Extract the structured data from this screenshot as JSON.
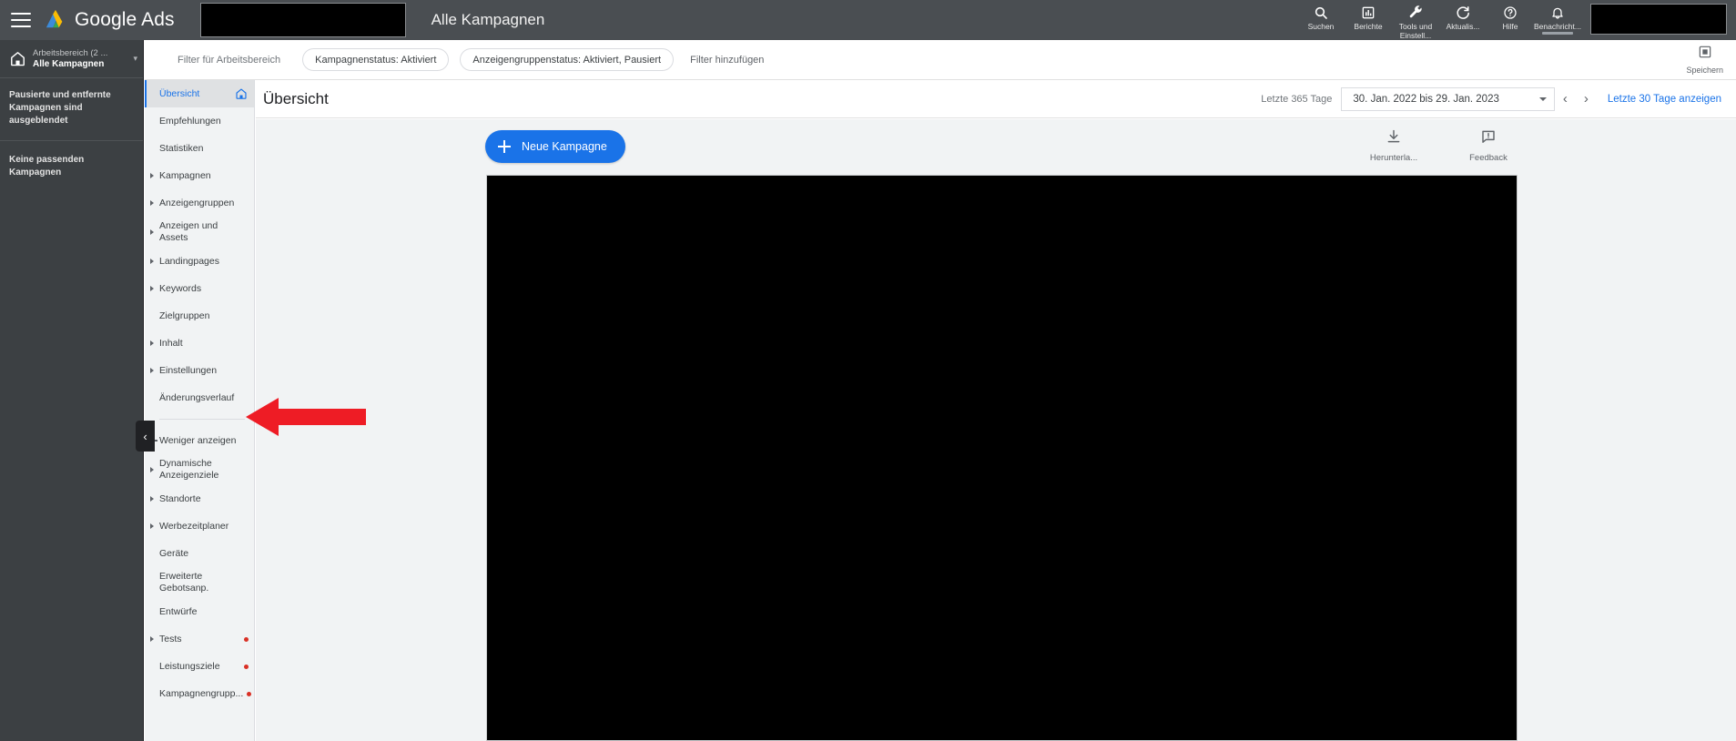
{
  "topbar": {
    "menu_icon": "hamburger-menu-icon",
    "logo_text": "Google Ads",
    "account_selector_value": "",
    "page_context_label": "Alle Kampagnen",
    "actions": [
      {
        "label": "Suchen",
        "icon": "search-icon"
      },
      {
        "label": "Berichte",
        "icon": "reports-bar-chart-icon"
      },
      {
        "label": "Tools und Einstell...",
        "icon": "wrench-tools-icon"
      },
      {
        "label": "Aktualis...",
        "icon": "refresh-icon"
      },
      {
        "label": "Hilfe",
        "icon": "help-question-icon"
      },
      {
        "label": "Benachricht...",
        "icon": "notification-bell-icon"
      }
    ],
    "user_badge_value": ""
  },
  "dark_sidebar": {
    "home_icon": "home-icon",
    "workspace_line1": "Arbeitsbereich (2 ...",
    "workspace_line2": "Alle Kampagnen",
    "workspace_caret": "chevron-down-icon",
    "note1": "Pausierte und entfernte Kampagnen sind ausgeblendet",
    "note2": "Keine passenden Kampagnen"
  },
  "filterbar": {
    "label": "Filter für Arbeitsbereich",
    "chips": [
      "Kampagnenstatus: Aktiviert",
      "Anzeigengruppenstatus: Aktiviert, Pausiert"
    ],
    "add_filter": "Filter hinzufügen",
    "save_label": "Speichern",
    "save_icon": "save-disk-icon"
  },
  "leftnav": {
    "items": [
      {
        "label": "Übersicht",
        "active": true,
        "expandable": false,
        "home": true,
        "dot": false
      },
      {
        "label": "Empfehlungen",
        "active": false,
        "expandable": false,
        "home": false,
        "dot": false
      },
      {
        "label": "Statistiken",
        "active": false,
        "expandable": false,
        "home": false,
        "dot": false
      },
      {
        "label": "Kampagnen",
        "active": false,
        "expandable": true,
        "home": false,
        "dot": false
      },
      {
        "label": "Anzeigengruppen",
        "active": false,
        "expandable": true,
        "home": false,
        "dot": false
      },
      {
        "label": "Anzeigen und Assets",
        "active": false,
        "expandable": true,
        "home": false,
        "dot": false
      },
      {
        "label": "Landingpages",
        "active": false,
        "expandable": true,
        "home": false,
        "dot": false
      },
      {
        "label": "Keywords",
        "active": false,
        "expandable": true,
        "home": false,
        "dot": false
      },
      {
        "label": "Zielgruppen",
        "active": false,
        "expandable": false,
        "home": false,
        "dot": false
      },
      {
        "label": "Inhalt",
        "active": false,
        "expandable": true,
        "home": false,
        "dot": false
      },
      {
        "label": "Einstellungen",
        "active": false,
        "expandable": true,
        "home": false,
        "dot": false
      },
      {
        "label": "Änderungsverlauf",
        "active": false,
        "expandable": false,
        "home": false,
        "dot": false
      }
    ],
    "less_label": "Weniger anzeigen",
    "items2": [
      {
        "label": "Dynamische Anzeigenziele",
        "active": false,
        "expandable": true,
        "home": false,
        "dot": false
      },
      {
        "label": "Standorte",
        "active": false,
        "expandable": true,
        "home": false,
        "dot": false
      },
      {
        "label": "Werbezeitplaner",
        "active": false,
        "expandable": true,
        "home": false,
        "dot": false
      },
      {
        "label": "Geräte",
        "active": false,
        "expandable": false,
        "home": false,
        "dot": false
      },
      {
        "label": "Erweiterte Gebotsanp.",
        "active": false,
        "expandable": false,
        "home": false,
        "dot": false
      },
      {
        "label": "Entwürfe",
        "active": false,
        "expandable": false,
        "home": false,
        "dot": false
      },
      {
        "label": "Tests",
        "active": false,
        "expandable": true,
        "home": false,
        "dot": true
      },
      {
        "label": "Leistungsziele",
        "active": false,
        "expandable": false,
        "home": false,
        "dot": true
      },
      {
        "label": "Kampagnengrupp...",
        "active": false,
        "expandable": false,
        "home": false,
        "dot": true
      }
    ],
    "collapse_icon": "chevron-left-icon"
  },
  "pageheader": {
    "title": "Übersicht",
    "date_prefix": "Letzte 365 Tage",
    "date_range": "30. Jan. 2022 bis 29. Jan. 2023",
    "prev_icon": "chevron-left-icon",
    "next_icon": "chevron-right-icon",
    "last30_link": "Letzte 30 Tage anzeigen"
  },
  "content": {
    "new_campaign_label": "Neue Kampagne",
    "new_campaign_icon": "plus-icon",
    "actions": [
      {
        "label": "Herunterla...",
        "icon": "download-icon"
      },
      {
        "label": "Feedback",
        "icon": "feedback-comment-icon"
      }
    ],
    "redacted_panel": ""
  },
  "annotation": {
    "arrow_icon": "red-left-arrow-annotation",
    "arrow_color": "#ee1c25"
  },
  "colors": {
    "topbar_bg": "#4a4e52",
    "sidebar_bg": "#3c4043",
    "nav_bg": "#f1f3f4",
    "accent_blue": "#1a73e8",
    "dot_red": "#d93025",
    "annotation_red": "#ee1c25"
  }
}
